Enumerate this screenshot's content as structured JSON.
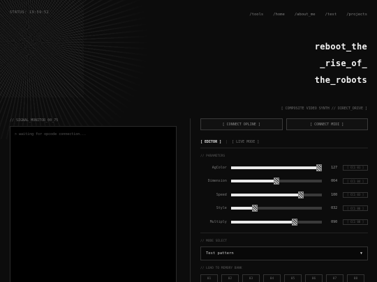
{
  "status": "STATUS: 19:59:52",
  "nav": [
    "/tools",
    "/home",
    "/about_me",
    "/test",
    "/projects"
  ],
  "title": [
    "reboot_the",
    "_rise_of_",
    "the_robots"
  ],
  "subtitle": "[ COMPOSITE VIDEO SYNTH // DIRECT_DRIVE ]",
  "monitor": {
    "label": "// SIGNAL_MONITOR_00_75",
    "message": "> waiting for opcode connection..."
  },
  "connect": {
    "opline": "[ CONNECT OPLINE ]",
    "midi": "[ CONNECT MIDI ]"
  },
  "tabs": {
    "editor": "[ EDITOR ]",
    "sep": "|",
    "live": "[ LIVE MODE ]"
  },
  "params_label": "// PARAMETERS",
  "params": [
    {
      "name": "AgColor",
      "value": "127",
      "fraction": 0.97,
      "cc": "[ CC1 01 ]"
    },
    {
      "name": "Dimension",
      "value": "064",
      "fraction": 0.5,
      "cc": "[ CC1 04 ]"
    },
    {
      "name": "Speed",
      "value": "100",
      "fraction": 0.77,
      "cc": "[ CC1 03 ]"
    },
    {
      "name": "Style",
      "value": "032",
      "fraction": 0.26,
      "cc": "[ CC1 06 ]"
    },
    {
      "name": "Multiply",
      "value": "090",
      "fraction": 0.7,
      "cc": "[ CC1 08 ]"
    }
  ],
  "mode": {
    "label": "// MODE SELECT",
    "selected": "Test pattern"
  },
  "memory": {
    "label": "// LOAD TO MEMORY BANK",
    "slots": [
      "01",
      "02",
      "03",
      "04",
      "05",
      "06",
      "07",
      "08"
    ]
  }
}
